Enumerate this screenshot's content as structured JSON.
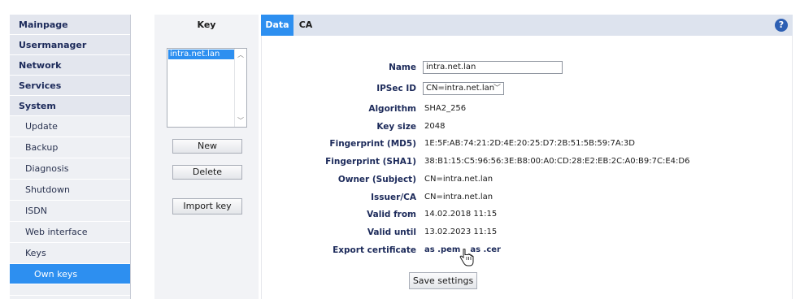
{
  "sidebar": {
    "items": [
      {
        "label": "Mainpage"
      },
      {
        "label": "Usermanager"
      },
      {
        "label": "Network"
      },
      {
        "label": "Services"
      },
      {
        "label": "System"
      },
      {
        "label": "Update"
      },
      {
        "label": "Backup"
      },
      {
        "label": "Diagnosis"
      },
      {
        "label": "Shutdown"
      },
      {
        "label": "ISDN"
      },
      {
        "label": "Web interface"
      },
      {
        "label": "Keys"
      },
      {
        "label": "Own keys"
      }
    ]
  },
  "key_panel": {
    "header": "Key",
    "list_items": [
      "intra.net.lan"
    ],
    "buttons": {
      "new": "New",
      "delete": "Delete",
      "import": "Import key"
    }
  },
  "tabs": {
    "data": "Data",
    "ca": "CA",
    "help": "?"
  },
  "form": {
    "name": {
      "label": "Name",
      "value": "intra.net.lan"
    },
    "ipsec_id": {
      "label": "IPSec ID",
      "value": "CN=intra.net.lan"
    },
    "algorithm": {
      "label": "Algorithm",
      "value": "SHA2_256"
    },
    "key_size": {
      "label": "Key size",
      "value": "2048"
    },
    "fp_md5": {
      "label": "Fingerprint (MD5)",
      "value": "1E:5F:AB:74:21:2D:4E:20:25:D7:2B:51:5B:59:7A:3D"
    },
    "fp_sha1": {
      "label": "Fingerprint (SHA1)",
      "value": "38:B1:15:C5:96:56:3E:B8:00:A0:CD:28:E2:EB:2C:A0:B9:7C:E4:D6"
    },
    "owner": {
      "label": "Owner (Subject)",
      "value": "CN=intra.net.lan"
    },
    "issuer": {
      "label": "Issuer/CA",
      "value": "CN=intra.net.lan"
    },
    "valid_from": {
      "label": "Valid from",
      "value": "14.02.2018 11:15"
    },
    "valid_until": {
      "label": "Valid until",
      "value": "13.02.2023 11:15"
    },
    "export": {
      "label": "Export certificate",
      "pem": "as .pem",
      "cer": "as .cer"
    },
    "save": "Save settings"
  }
}
